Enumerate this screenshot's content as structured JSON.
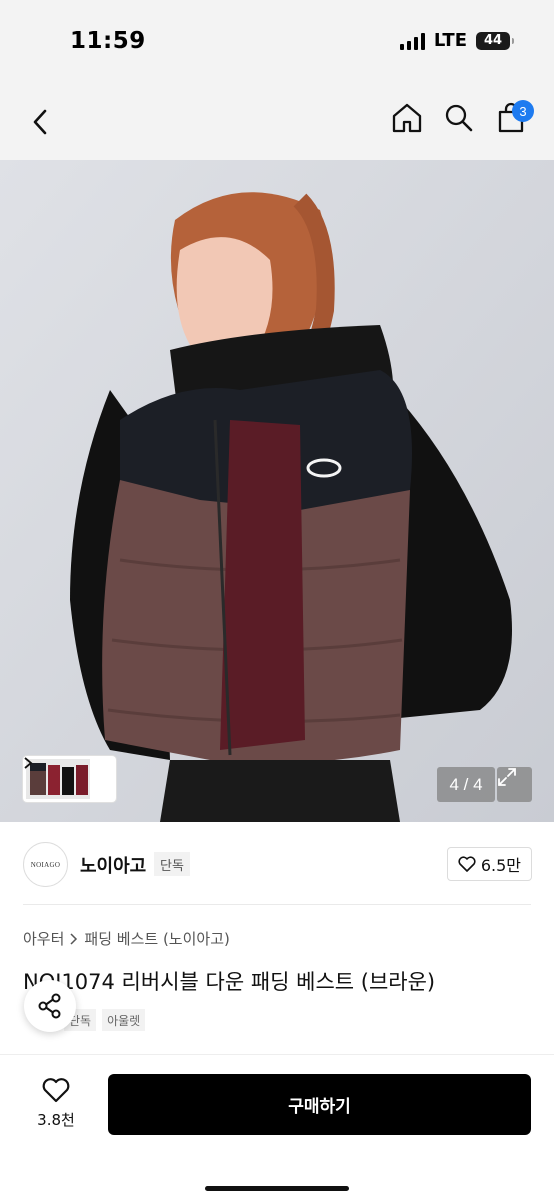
{
  "status": {
    "time": "11:59",
    "network": "LTE",
    "battery": "44"
  },
  "nav": {
    "cart_count": "3"
  },
  "gallery": {
    "counter": "4 / 4"
  },
  "brand": {
    "logo_text": "NOIAGO",
    "name": "노이아고",
    "tag": "단독",
    "likes": "6.5만"
  },
  "product": {
    "breadcrumb": [
      "아우터",
      "패딩 베스트 (노이아고)"
    ],
    "title": "NOI1074 리버시블 다운 패딩 베스트 (브라운)",
    "tags": [
      "단독",
      "아울렛"
    ]
  },
  "bottom": {
    "wish_count": "3.8천",
    "buy_label": "구매하기"
  },
  "colors": {
    "accent": "#1e7bf0",
    "buy_button": "#000000"
  }
}
